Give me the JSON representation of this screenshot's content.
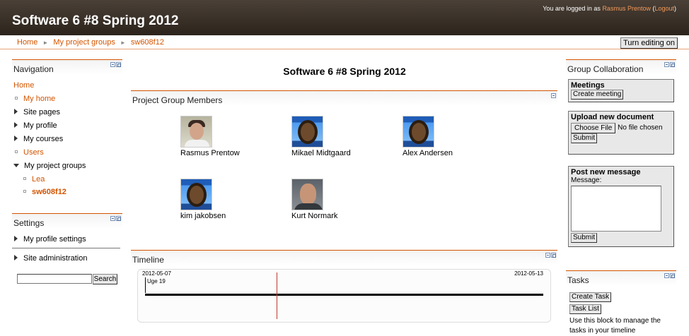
{
  "header": {
    "site_title": "Software 6 #8 Spring 2012",
    "login_prefix": "You are logged in as",
    "login_user": "Rasmus Prentow",
    "logout_label": "Logout"
  },
  "navbar": {
    "breadcrumb": [
      "Home",
      "My project groups",
      "sw608f12"
    ],
    "breadcrumb_separator": "►",
    "turn_editing_label": "Turn editing on"
  },
  "navigation": {
    "title": "Navigation",
    "items": [
      {
        "label": "Home",
        "kind": "root-link",
        "icon": "none"
      },
      {
        "label": "My home",
        "kind": "link",
        "icon": "bullet-square"
      },
      {
        "label": "Site pages",
        "kind": "text",
        "icon": "triangle-right"
      },
      {
        "label": "My profile",
        "kind": "text",
        "icon": "triangle-right"
      },
      {
        "label": "My courses",
        "kind": "text",
        "icon": "triangle-right"
      },
      {
        "label": "Users",
        "kind": "link",
        "icon": "bullet-square"
      },
      {
        "label": "My project groups",
        "kind": "text",
        "icon": "triangle-down"
      },
      {
        "label": "Lea",
        "kind": "link",
        "icon": "bullet-square"
      },
      {
        "label": "sw608f12",
        "kind": "link-bold",
        "icon": "bullet-square"
      }
    ]
  },
  "settings": {
    "title": "Settings",
    "items": [
      "My profile settings",
      "Site administration"
    ],
    "search_button": "Search",
    "search_value": ""
  },
  "main": {
    "course_title": "Software 6 #8 Spring 2012",
    "members_title": "Project Group Members",
    "members": [
      {
        "name": "Rasmus Prentow",
        "avatar": "photo-person"
      },
      {
        "name": "Mikael Midtgaard",
        "avatar": "default-avatar"
      },
      {
        "name": "Alex Andersen",
        "avatar": "default-avatar"
      },
      {
        "name": "kim jakobsen",
        "avatar": "default-avatar"
      },
      {
        "name": "Kurt Normark",
        "avatar": "photo-person"
      }
    ],
    "timeline": {
      "title": "Timeline",
      "start_date": "2012-05-07",
      "end_date": "2012-05-13",
      "week_label": "Uge 19",
      "now_marker_color": "#c0392b"
    }
  },
  "right": {
    "collab_title": "Group Collaboration",
    "meetings": {
      "title": "Meetings",
      "button": "Create meeting"
    },
    "upload": {
      "title": "Upload new document",
      "choose_button": "Choose File",
      "file_status": "No file chosen",
      "submit": "Submit"
    },
    "message": {
      "title": "Post new message",
      "label": "Message:",
      "value": "",
      "submit": "Submit"
    },
    "tasks": {
      "title": "Tasks",
      "create_button": "Create Task",
      "list_button": "Task List",
      "description": "Use this block to manage the tasks in your timeline"
    }
  },
  "colors": {
    "header_bg": "#2c241c",
    "accent": "#d35400",
    "link": "#d35400"
  }
}
